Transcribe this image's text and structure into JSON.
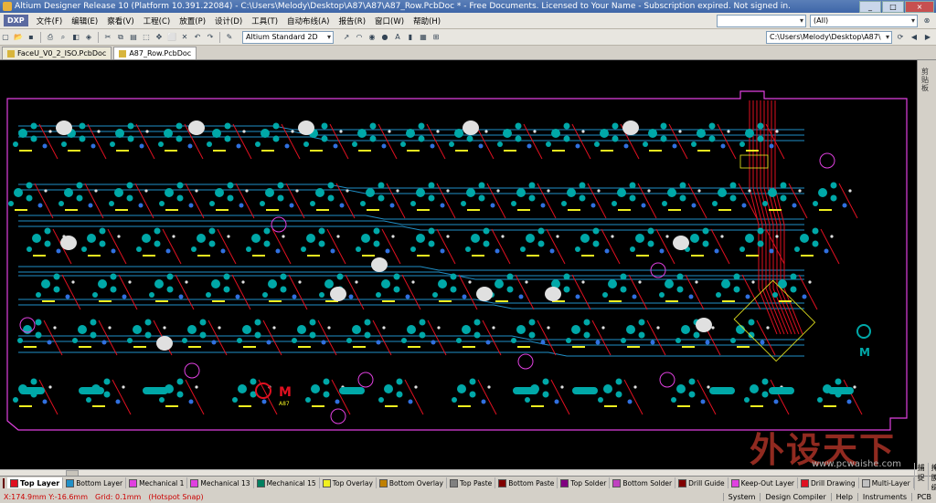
{
  "window": {
    "title": "Altium Designer Release 10 (Platform 10.391.22084) - C:\\Users\\Melody\\Desktop\\A87\\A87\\A87_Row.PcbDoc * - Free Documents. Licensed to Your Name - Subscription expired. Not signed in.",
    "buttons": [
      "_",
      "□",
      "×"
    ]
  },
  "menu": {
    "logo": "DXP",
    "items": [
      "文件(F)",
      "编辑(E)",
      "察看(V)",
      "工程(C)",
      "放置(P)",
      "设计(D)",
      "工具(T)",
      "自动布线(A)",
      "报告(R)",
      "窗口(W)",
      "帮助(H)"
    ],
    "filter_value": "(All)"
  },
  "toolbar": {
    "view_mode": "Altium Standard 2D",
    "path": "C:\\Users\\Melody\\Desktop\\A87\\"
  },
  "documents": {
    "tabs": [
      "FaceU_V0_2_ISO.PcbDoc",
      "A87_Row.PcbDoc"
    ]
  },
  "board": {
    "logo_letter": "M",
    "logo_text": "A87"
  },
  "layers": {
    "current_indicator": "LS",
    "tabs": [
      {
        "name": "Top Layer",
        "color": "#e01020"
      },
      {
        "name": "Bottom Layer",
        "color": "#2090c8"
      },
      {
        "name": "Mechanical 1",
        "color": "#e040e0"
      },
      {
        "name": "Mechanical 13",
        "color": "#e040e0"
      },
      {
        "name": "Mechanical 15",
        "color": "#008060"
      },
      {
        "name": "Top Overlay",
        "color": "#f0f020"
      },
      {
        "name": "Bottom Overlay",
        "color": "#c08000"
      },
      {
        "name": "Top Paste",
        "color": "#808080"
      },
      {
        "name": "Bottom Paste",
        "color": "#800000"
      },
      {
        "name": "Top Solder",
        "color": "#800080"
      },
      {
        "name": "Bottom Solder",
        "color": "#c040c0"
      },
      {
        "name": "Drill Guide",
        "color": "#800000"
      },
      {
        "name": "Keep-Out Layer",
        "color": "#e040e0"
      },
      {
        "name": "Drill Drawing",
        "color": "#e01020"
      },
      {
        "name": "Multi-Layer",
        "color": "#c0c0c0"
      }
    ],
    "right_buttons": [
      "捕捉",
      "掩膜级别",
      "清除"
    ]
  },
  "status": {
    "coords": "X:174.9mm Y:-16.6mm",
    "grid": "Grid: 0.1mm",
    "snap": "(Hotspot Snap)",
    "panels": [
      "System",
      "Design Compiler",
      "Help",
      "Instruments",
      "PCB"
    ]
  },
  "right_panel": {
    "label": "剪贴板"
  },
  "watermark": {
    "text": "外设天下",
    "url": "www.pcwaishe.com"
  },
  "colors": {
    "board_outline": "#e040e0",
    "pad": "#00a8a8",
    "via": "#e0e0e0",
    "top_trace": "#e01020",
    "bottom_trace": "#2090c8",
    "silk": "#f0f020"
  }
}
